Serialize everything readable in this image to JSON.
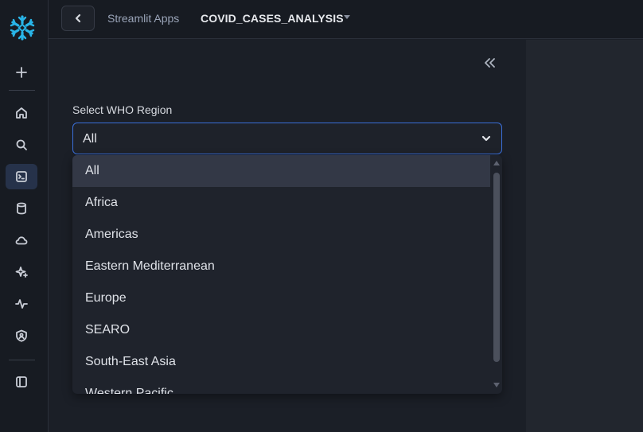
{
  "topbar": {
    "back_label": "Back",
    "crumb_parent": "Streamlit Apps",
    "crumb_current": "COVID_CASES_ANALYSIS"
  },
  "rail": {
    "items": [
      {
        "name": "create",
        "icon": "plus-icon"
      },
      {
        "name": "home",
        "icon": "home-icon"
      },
      {
        "name": "search",
        "icon": "search-icon"
      },
      {
        "name": "projects",
        "icon": "terminal-icon",
        "active": true
      },
      {
        "name": "data",
        "icon": "database-icon"
      },
      {
        "name": "cloud",
        "icon": "cloud-icon"
      },
      {
        "name": "ai",
        "icon": "sparkle-icon"
      },
      {
        "name": "monitoring",
        "icon": "activity-icon"
      },
      {
        "name": "admin",
        "icon": "shield-icon"
      },
      {
        "name": "toggle-sidebar",
        "icon": "sidebar-icon"
      }
    ],
    "brand_color": "#29b5e8"
  },
  "panel": {
    "field_label": "Select WHO Region",
    "selected_value": "All",
    "accent_color": "#3a6fd9"
  },
  "dropdown": {
    "options": [
      "All",
      "Africa",
      "Americas",
      "Eastern Mediterranean",
      "Europe",
      "SEARO",
      "South-East Asia",
      "Western Pacific"
    ],
    "selected_index": 0
  }
}
